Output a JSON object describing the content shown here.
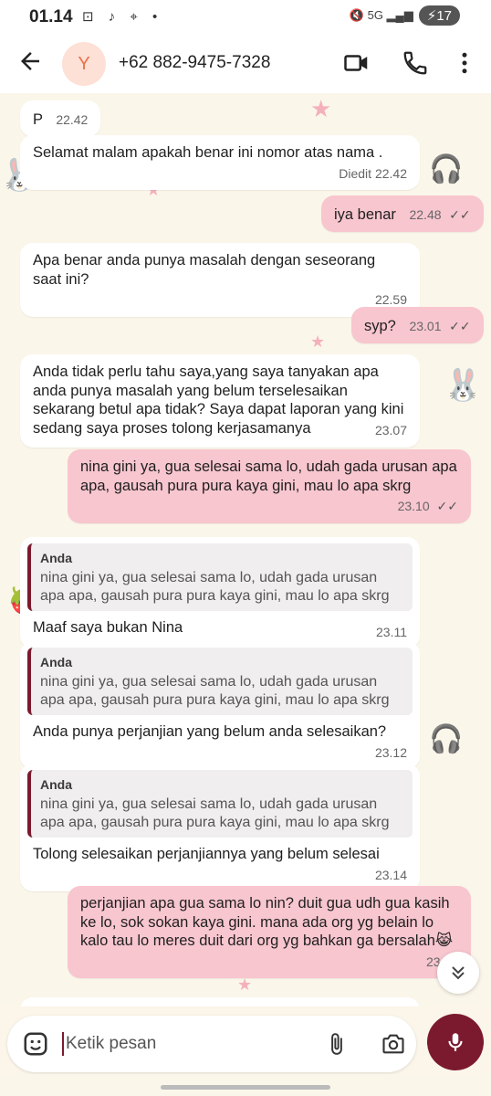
{
  "status": {
    "time": "01.14",
    "icons": "⊡ ♪ ⌖ •",
    "right_icons": "🔇 5G ▂▄▆",
    "battery": "17"
  },
  "header": {
    "avatar_letter": "Y",
    "contact": "+62 882-9475-7328"
  },
  "messages": [
    {
      "dir": "in",
      "text": "P",
      "time": "22.42"
    },
    {
      "dir": "in",
      "text": "Selamat malam apakah benar ini nomor atas nama .",
      "edited": "Diedit",
      "time": "22.42"
    },
    {
      "dir": "out",
      "text": "iya benar",
      "time": "22.48",
      "ticks": "✓✓"
    },
    {
      "dir": "in",
      "text": "Apa benar anda punya masalah dengan seseorang saat ini?",
      "time": "22.59"
    },
    {
      "dir": "out",
      "text": "syp?",
      "time": "23.01",
      "ticks": "✓✓"
    },
    {
      "dir": "in",
      "text": "Anda tidak perlu tahu saya,yang saya tanyakan apa anda punya masalah yang belum terselesaikan sekarang betul apa tidak? Saya dapat laporan yang kini sedang saya proses tolong kerjasamanya",
      "time": "23.07"
    },
    {
      "dir": "out",
      "text": "nina gini ya, gua selesai sama lo, udah gada urusan apa apa, gausah pura pura kaya gini, mau lo apa skrg",
      "time": "23.10",
      "ticks": "✓✓"
    },
    {
      "dir": "in",
      "quote_name": "Anda",
      "quote_text": "nina gini ya, gua selesai sama lo, udah gada urusan apa apa, gausah pura pura kaya gini, mau lo apa skrg",
      "text": "Maaf saya bukan Nina",
      "time": "23.11"
    },
    {
      "dir": "in",
      "quote_name": "Anda",
      "quote_text": "nina gini ya, gua selesai sama lo, udah gada urusan apa apa, gausah pura pura kaya gini, mau lo apa skrg",
      "text": "Anda punya perjanjian yang belum anda selesaikan?",
      "time": "23.12"
    },
    {
      "dir": "in",
      "quote_name": "Anda",
      "quote_text": "nina gini ya, gua selesai sama lo, udah gada urusan apa apa, gausah pura pura kaya gini, mau lo apa skrg",
      "text": "Tolong selesaikan perjanjiannya yang belum selesai",
      "time": "23.14"
    },
    {
      "dir": "out",
      "text": "perjanjian apa gua sama lo nin? duit gua udh gua kasih ke lo, sok sokan kaya gini. mana ada org yg belain lo kalo tau lo meres duit dari org yg bahkan ga bersalah😹",
      "time": "23.15"
    }
  ],
  "input": {
    "placeholder": "Ketik pesan"
  },
  "colors": {
    "accent": "#7b1a2e",
    "outgoing": "#f8c6cf",
    "incoming": "#ffffff"
  }
}
